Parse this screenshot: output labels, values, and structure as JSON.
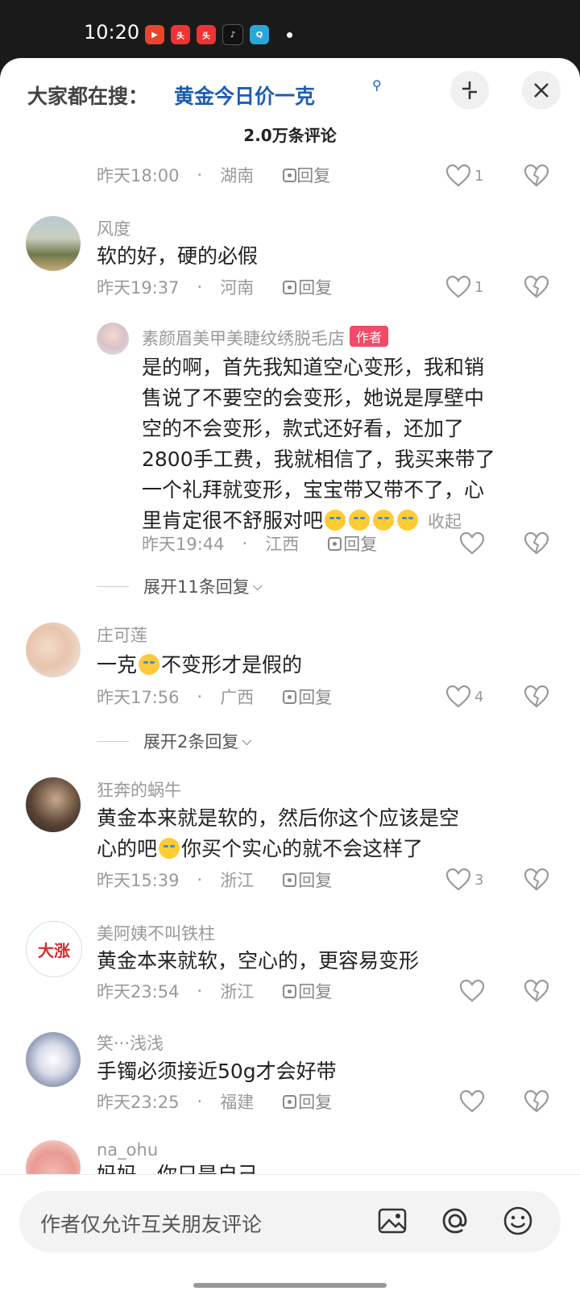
{
  "status_bar": {
    "time": "10:20",
    "app_icons": [
      "video-app-icon",
      "toutiao-icon",
      "toutiao-icon",
      "tiktok-icon",
      "search-app-icon"
    ]
  },
  "header": {
    "search_prefix": "大家都在搜：",
    "search_term": "黄金今日价一克",
    "comment_count": "2.0万条评论"
  },
  "comments": [
    {
      "time": "昨天18:00",
      "location": "湖南",
      "reply": "回复",
      "likes": "1"
    },
    {
      "user": "风度",
      "text": "软的好，硬的必假",
      "time": "昨天19:37",
      "location": "河南",
      "reply": "回复",
      "likes": "1"
    },
    {
      "user": "素颜眉美甲美睫纹绣脱毛店",
      "badge": "作者",
      "lines": [
        "是的啊，首先我知道空心变形，我和销",
        "售说了不要空的会变形，她说是厚壁中",
        "空的不会变形，款式还好看，还加了",
        "2800手工费，我就相信了，我买来带了",
        "一个礼拜就变形，宝宝带又带不了，心",
        "里肯定很不舒服对吧"
      ],
      "collapse": "收起",
      "time": "昨天19:44",
      "location": "江西",
      "reply": "回复",
      "likes": ""
    },
    {
      "expand": "展开11条回复"
    },
    {
      "user": "庄可莲",
      "text_a": "一克",
      "text_b": "不变形才是假的",
      "time": "昨天17:56",
      "location": "广西",
      "reply": "回复",
      "likes": "4"
    },
    {
      "expand": "展开2条回复"
    },
    {
      "user": "狂奔的蜗牛",
      "line1": "黄金本来就是软的，然后你这个应该是空",
      "line2a": "心的吧",
      "line2b": "你买个实心的就不会这样了",
      "time": "昨天15:39",
      "location": "浙江",
      "reply": "回复",
      "likes": "3"
    },
    {
      "user": "美阿姨不叫铁柱",
      "avatar_text": "大涨",
      "text": "黄金本来就软，空心的，更容易变形",
      "time": "昨天23:54",
      "location": "浙江",
      "reply": "回复",
      "likes": ""
    },
    {
      "user": "笑···浅浅",
      "text": "手镯必须接近50g才会好带",
      "time": "昨天23:25",
      "location": "福建",
      "reply": "回复",
      "likes": ""
    },
    {
      "user": "na_ohu",
      "text": "妈妈，你只是自己"
    }
  ],
  "input": {
    "placeholder": "作者仅允许互关朋友评论"
  },
  "colors": {
    "accent_blue": "#1d5db0",
    "badge_red": "#f24a67"
  }
}
